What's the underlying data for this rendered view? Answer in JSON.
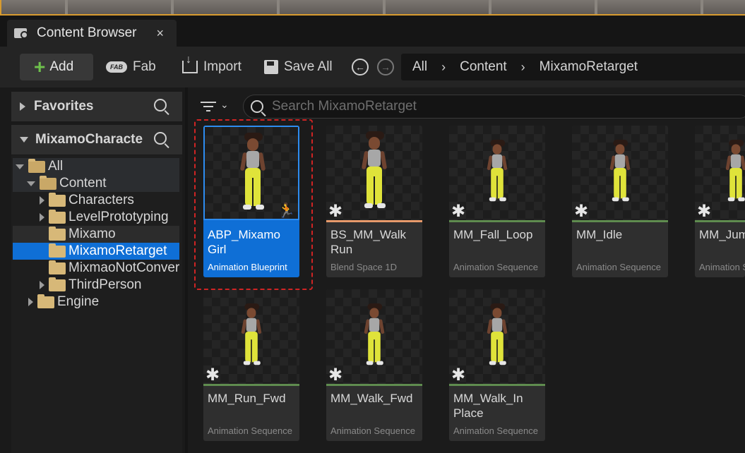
{
  "tab": {
    "title": "Content Browser",
    "close": "×"
  },
  "toolbar": {
    "add_label": "Add",
    "fab_label": "Fab",
    "fab_logo": "FAB",
    "import_label": "Import",
    "saveall_label": "Save All"
  },
  "breadcrumb": [
    "All",
    "Content",
    "MixamoRetarget"
  ],
  "favorites": {
    "label": "Favorites"
  },
  "project": {
    "label": "MixamoCharacte"
  },
  "tree": [
    {
      "label": "All",
      "expander": "down"
    },
    {
      "label": "Content",
      "expander": "down"
    },
    {
      "label": "Characters",
      "expander": "right"
    },
    {
      "label": "LevelPrototyping",
      "expander": "right"
    },
    {
      "label": "Mixamo",
      "expander": "none"
    },
    {
      "label": "MixamoRetarget",
      "expander": "none"
    },
    {
      "label": "MixmaoNotConverted",
      "expander": "none"
    },
    {
      "label": "ThirdPerson",
      "expander": "right"
    },
    {
      "label": "Engine",
      "expander": "right"
    }
  ],
  "search": {
    "placeholder": "Search MixamoRetarget"
  },
  "assets": [
    {
      "name": "ABP_Mixamo Girl",
      "type": "Animation Blueprint"
    },
    {
      "name": "BS_MM_Walk Run",
      "type": "Blend Space 1D"
    },
    {
      "name": "MM_Fall_Loop",
      "type": "Animation Sequence"
    },
    {
      "name": "MM_Idle",
      "type": "Animation Sequence"
    },
    {
      "name": "MM_Jump",
      "type": "Animation Sequence"
    },
    {
      "name": "MM_Run_Fwd",
      "type": "Animation Sequence"
    },
    {
      "name": "MM_Walk_Fwd",
      "type": "Animation Sequence"
    },
    {
      "name": "MM_Walk_In Place",
      "type": "Animation Sequence"
    }
  ],
  "colors": {
    "accent": "#0f6fd6",
    "add_plus": "#6ec04c",
    "anim_strip": "#5f8c4f",
    "blendspace_strip": "#e79a6b",
    "selection_dash": "#d02424"
  }
}
